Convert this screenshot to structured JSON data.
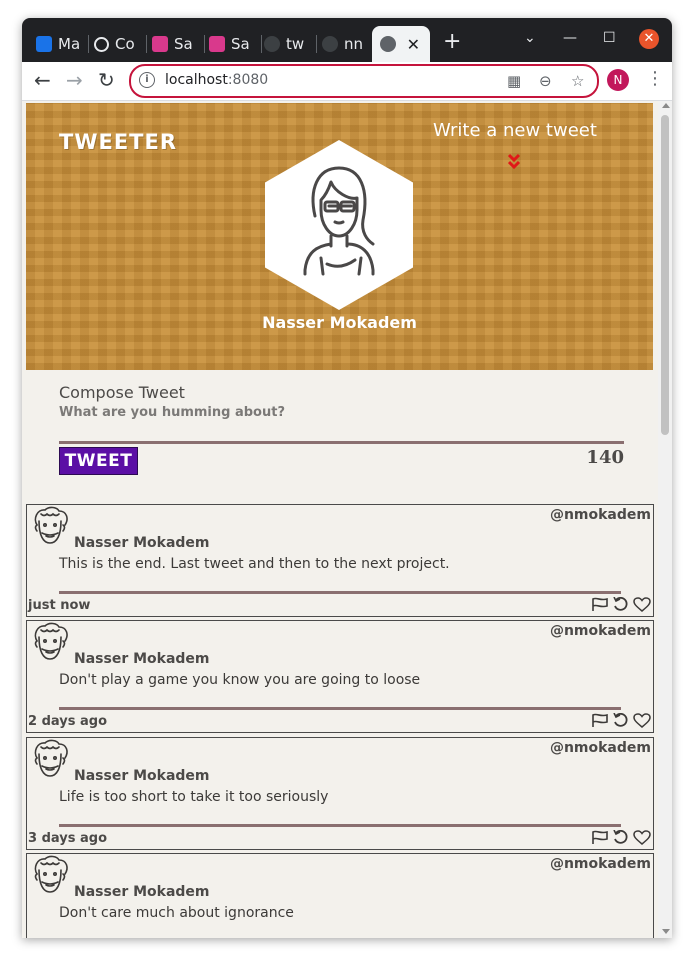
{
  "browser": {
    "tabs": [
      {
        "label": "Ma",
        "favicon_color": "#1a73e8"
      },
      {
        "label": "Co",
        "favicon_color": "#202124"
      },
      {
        "label": "Sa",
        "favicon_color": "#d9398c"
      },
      {
        "label": "Sa",
        "favicon_color": "#d9398c"
      },
      {
        "label": "tw",
        "favicon_color": "#3c4043"
      },
      {
        "label": "nn",
        "favicon_color": "#3c4043"
      }
    ],
    "new_tab": "+",
    "url_host": "localhost",
    "url_port": ":8080",
    "profile_initial": "N"
  },
  "header": {
    "logo": "Tweeter",
    "write_label": "Write a new tweet",
    "chevron": "»",
    "user_name": "Nasser Mokadem"
  },
  "compose": {
    "title": "Compose Tweet",
    "placeholder": "What are you humming about?",
    "button_label": "Tweet",
    "counter": "140"
  },
  "tweets": [
    {
      "name": "Nasser Mokadem",
      "handle": "@nmokadem",
      "text": "This is the end. Last tweet and then to the next project.",
      "date": "just now"
    },
    {
      "name": "Nasser Mokadem",
      "handle": "@nmokadem",
      "text": "Don't play a game you know you are going to loose",
      "date": "2 days ago"
    },
    {
      "name": "Nasser Mokadem",
      "handle": "@nmokadem",
      "text": "Life is too short to take it too seriously",
      "date": "3 days ago"
    },
    {
      "name": "Nasser Mokadem",
      "handle": "@nmokadem",
      "text": "Don't care much about ignorance",
      "date": ""
    }
  ],
  "colors": {
    "hero": "#c58e3c",
    "accent_button": "#5b0fa5",
    "divider": "#8a6f70",
    "chevron": "#e01818"
  },
  "icons": {
    "flag": "flag-icon",
    "retweet": "retweet-icon",
    "like": "heart-icon"
  }
}
